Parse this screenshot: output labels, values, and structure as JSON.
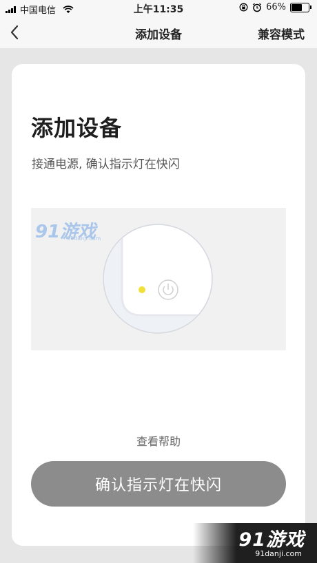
{
  "status_bar": {
    "carrier": "中国电信",
    "time": "上午11:35",
    "battery": "66%",
    "battery_level": 0.66
  },
  "nav": {
    "title": "添加设备",
    "right_action": "兼容模式"
  },
  "card": {
    "title": "添加设备",
    "subtitle": "接通电源, 确认指示灯在快闪",
    "illustration_logo": "91游戏",
    "illustration_logo_url": "91danji.com",
    "help_link": "查看帮助",
    "confirm_button": "确认指示灯在快闪"
  },
  "watermark": {
    "logo": "91游戏",
    "url": "91danji.com"
  },
  "colors": {
    "indicator_led": "#f2e03a",
    "button_bg": "#8c8c8c"
  }
}
